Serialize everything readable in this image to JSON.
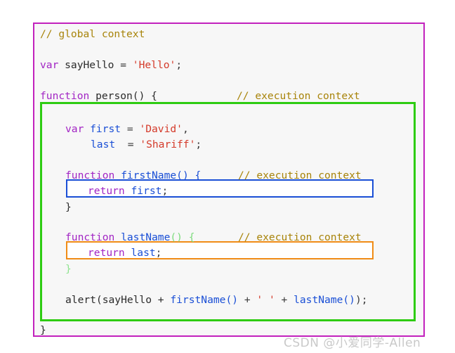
{
  "panel": {
    "border_color": "#c221bd",
    "background": "#f7f7f7"
  },
  "boxes": {
    "execution_context_outer": {
      "color": "#2ecc12",
      "label": "green-execution-context-box"
    },
    "first_name_scope": {
      "color": "#1a4fd6",
      "label": "blue-return-first-box"
    },
    "last_name_scope": {
      "color": "#f08c16",
      "label": "orange-return-last-box"
    }
  },
  "colors": {
    "keyword": "#a225c4",
    "identifier": "#2b2b2b",
    "function_name": "#1a4fd6",
    "string": "#d43a2a",
    "comment": "#a8840a",
    "brace_green": "#8ee38e"
  },
  "code": {
    "line1_comment": "// global context",
    "line3_kw": "var",
    "line3_ident": " sayHello = ",
    "line3_str": "'Hello'",
    "line3_semi": ";",
    "line5_kw": "function",
    "line5_ident": " person() {",
    "line5_comment": "// execution context",
    "line7_kw": "var",
    "line7_name": " first",
    "line7_eq": " = ",
    "line7_str": "'David'",
    "line7_comma": ",",
    "line8_name": "last ",
    "line8_eq": " = ",
    "line8_str": "'Shariff'",
    "line8_semi": ";",
    "line10_kw": "function",
    "line10_name": " firstName",
    "line10_paren": "() {",
    "line10_comment": "// execution context",
    "line11_kw": "return",
    "line11_name": " first",
    "line11_semi": ";",
    "line12_brace": "}",
    "line14_kw": "function",
    "line14_name": " lastName",
    "line14_paren": "() {",
    "line14_comment": "// execution context",
    "line15_kw": "return",
    "line15_name": " last",
    "line15_semi": ";",
    "line16_brace": "}",
    "line18_alert": "alert(sayHello + ",
    "line18_first": "firstName()",
    "line18_plus1": " + ",
    "line18_space_str": "' '",
    "line18_plus2": " + ",
    "line18_last": "lastName()",
    "line18_tail": ");",
    "line20_brace": "}"
  },
  "watermark": {
    "text": "CSDN @小爱同学-Allen"
  }
}
